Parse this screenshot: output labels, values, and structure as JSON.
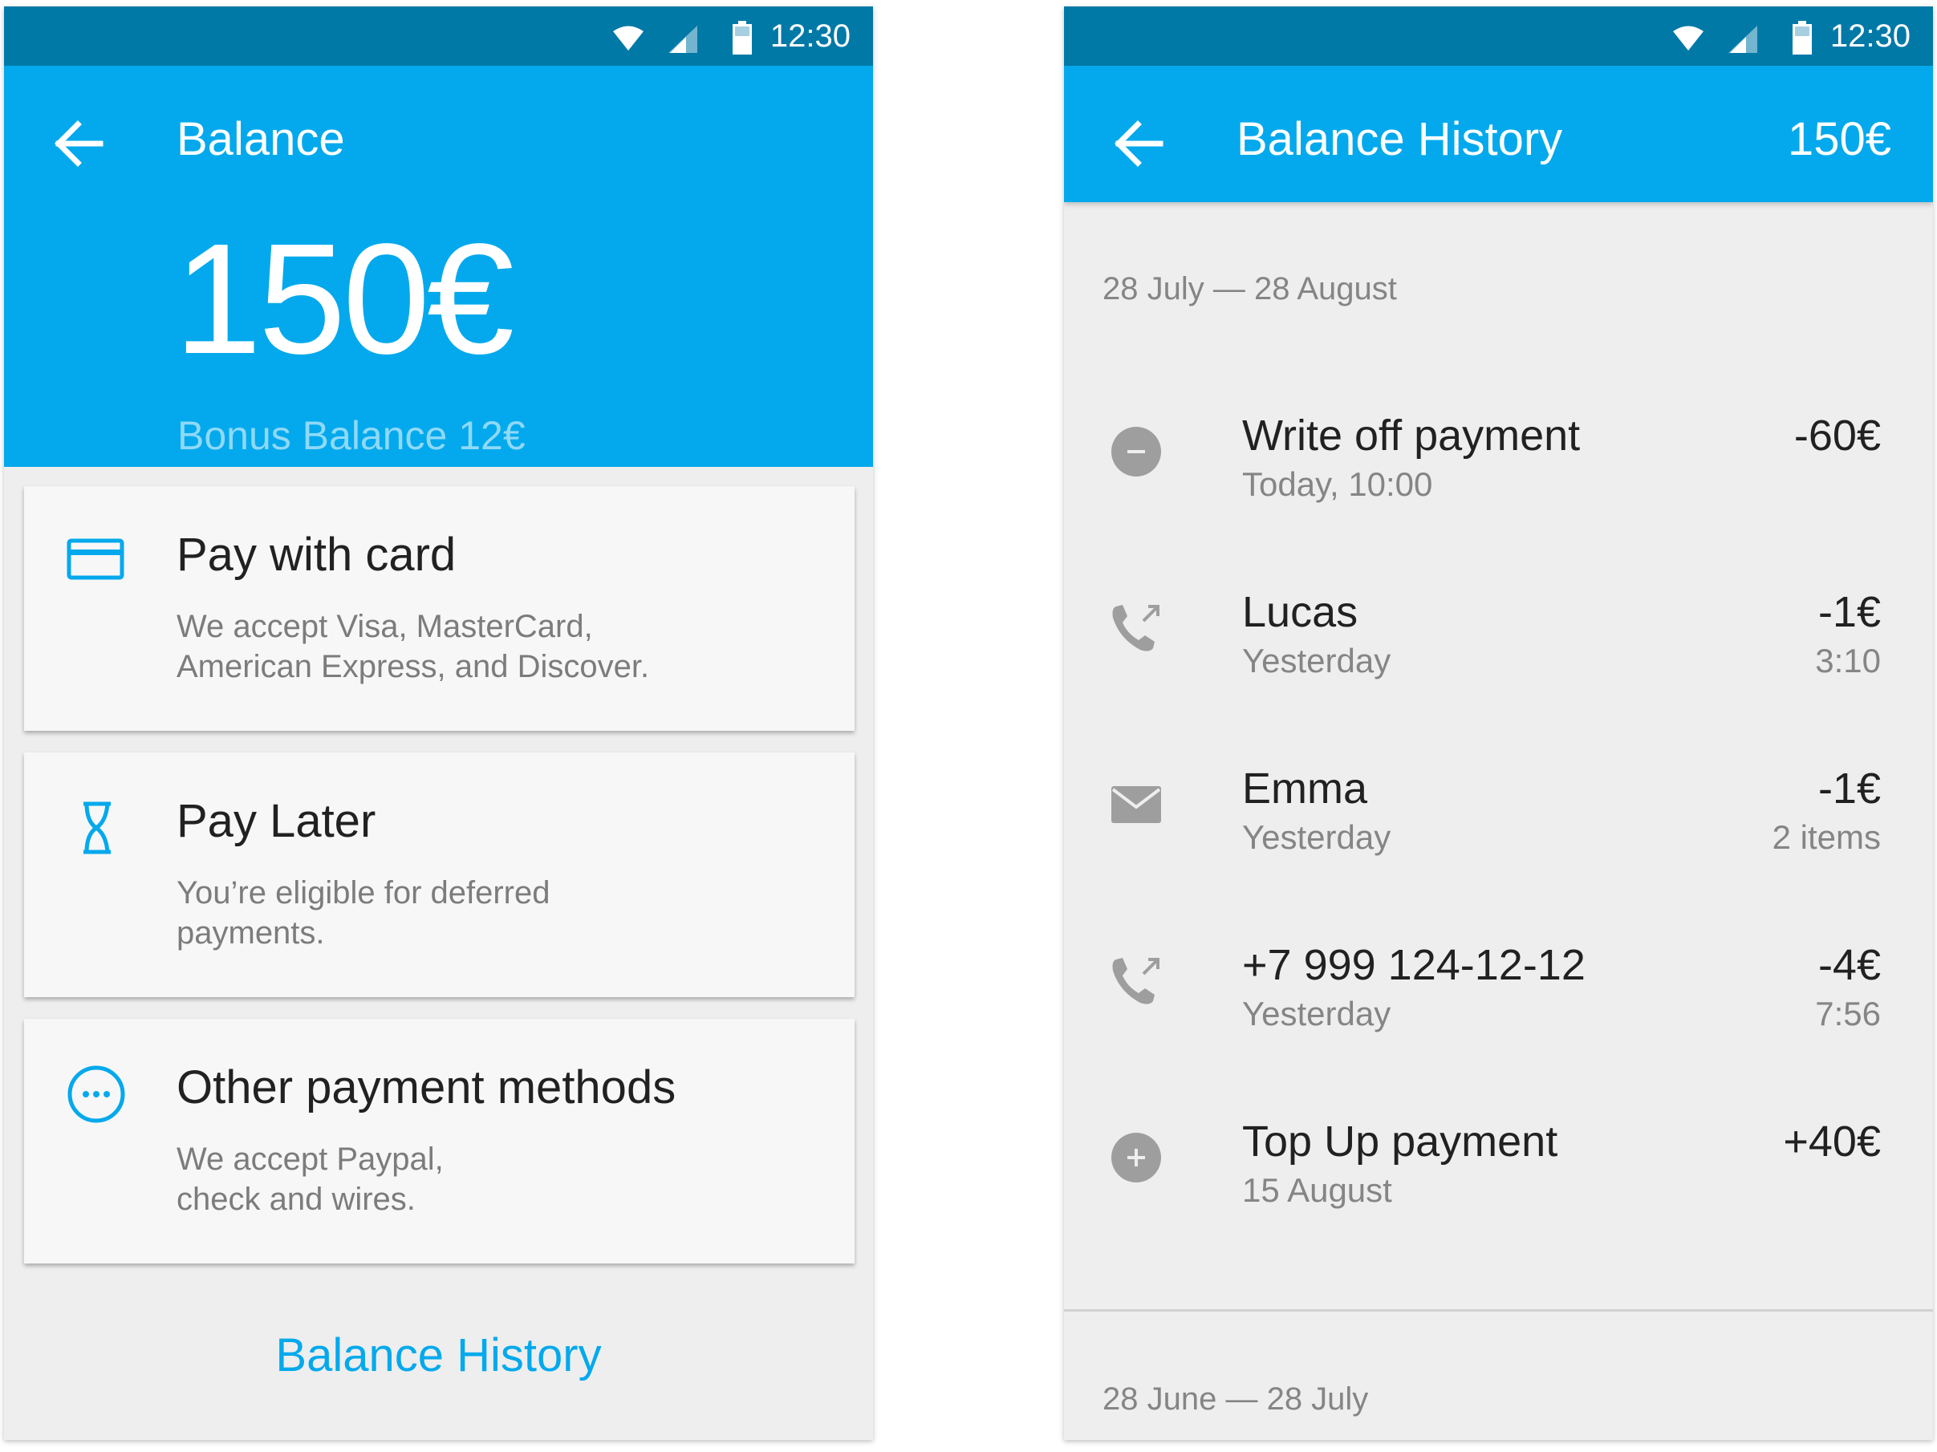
{
  "colors": {
    "status_bar": "#0179a7",
    "app_bar": "#03a9ec",
    "accent": "#03a9ec",
    "background": "#eeeeee",
    "card": "#f7f7f7",
    "icon_grey": "#9e9e9e"
  },
  "status_bar": {
    "time": "12:30",
    "icons": [
      "wifi-icon",
      "signal-icon",
      "battery-icon"
    ]
  },
  "balance_screen": {
    "title": "Balance",
    "amount": "150€",
    "bonus": "Bonus Balance 12€",
    "cards": [
      {
        "icon": "credit-card-icon",
        "title": "Pay with card",
        "desc_line1": "We accept Visa, MasterCard,",
        "desc_line2": "American Express, and Discover."
      },
      {
        "icon": "hourglass-icon",
        "title": "Pay Later",
        "desc_line1": "You’re eligible for deferred",
        "desc_line2": "payments."
      },
      {
        "icon": "more-circle-icon",
        "title": "Other payment methods",
        "desc_line1": "We accept Paypal,",
        "desc_line2": "check and wires."
      }
    ],
    "history_link": "Balance History"
  },
  "history_screen": {
    "title": "Balance History",
    "balance": "150€",
    "period_current": "28 July — 28 August",
    "period_previous": "28 June — 28 July",
    "items": [
      {
        "icon": "minus-circle-icon",
        "title": "Write off payment",
        "subtitle": "Today, 10:00",
        "amount": "-60€",
        "detail": ""
      },
      {
        "icon": "outgoing-call-icon",
        "title": "Lucas",
        "subtitle": "Yesterday",
        "amount": "-1€",
        "detail": "3:10"
      },
      {
        "icon": "mail-icon",
        "title": "Emma",
        "subtitle": "Yesterday",
        "amount": "-1€",
        "detail": "2 items"
      },
      {
        "icon": "outgoing-call-icon",
        "title": "+7 999 124-12-12",
        "subtitle": "Yesterday",
        "amount": "-4€",
        "detail": "7:56"
      },
      {
        "icon": "plus-circle-icon",
        "title": "Top Up payment",
        "subtitle": "15 August",
        "amount": "+40€",
        "detail": ""
      }
    ]
  }
}
